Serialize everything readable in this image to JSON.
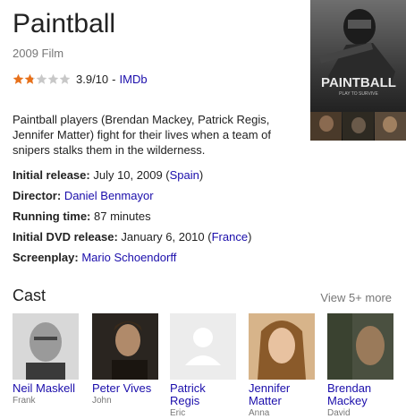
{
  "title": "Paintball",
  "subtitle": "2009 Film",
  "rating": {
    "stars_filled": 2,
    "stars_total": 5,
    "score": "3.9/10",
    "source": "IMDb"
  },
  "poster": {
    "logo_text": "PAINTBALL",
    "tagline": "PLAY TO SURVIVE"
  },
  "description": "Paintball players (Brendan Mackey, Patrick Regis, Jennifer Matter) fight for their lives when a team of snipers stalks them in the wilderness.",
  "facts": {
    "release": {
      "label": "Initial release:",
      "value": "July 10, 2009",
      "paren_open": " (",
      "link": "Spain",
      "paren_close": ")"
    },
    "director": {
      "label": "Director:",
      "link": "Daniel Benmayor"
    },
    "running": {
      "label": "Running time:",
      "value": "87 minutes"
    },
    "dvd": {
      "label": "Initial DVD release:",
      "value": "January 6, 2010",
      "paren_open": " (",
      "link": "France",
      "paren_close": ")"
    },
    "screenplay": {
      "label": "Screenplay:",
      "link": "Mario Schoendorff"
    }
  },
  "cast": {
    "title": "Cast",
    "view_more": "View 5+ more",
    "members": [
      {
        "name": "Neil Maskell",
        "role": "Frank"
      },
      {
        "name": "Peter Vives",
        "role": "John"
      },
      {
        "name": "Patrick Regis",
        "role": "Eric"
      },
      {
        "name": "Jennifer Matter",
        "role": "Anna"
      },
      {
        "name": "Brendan Mackey",
        "role": "David"
      }
    ]
  },
  "colors": {
    "star_filled": "#e7711b",
    "star_empty": "#c8c8c8",
    "link": "#1a0dab"
  }
}
